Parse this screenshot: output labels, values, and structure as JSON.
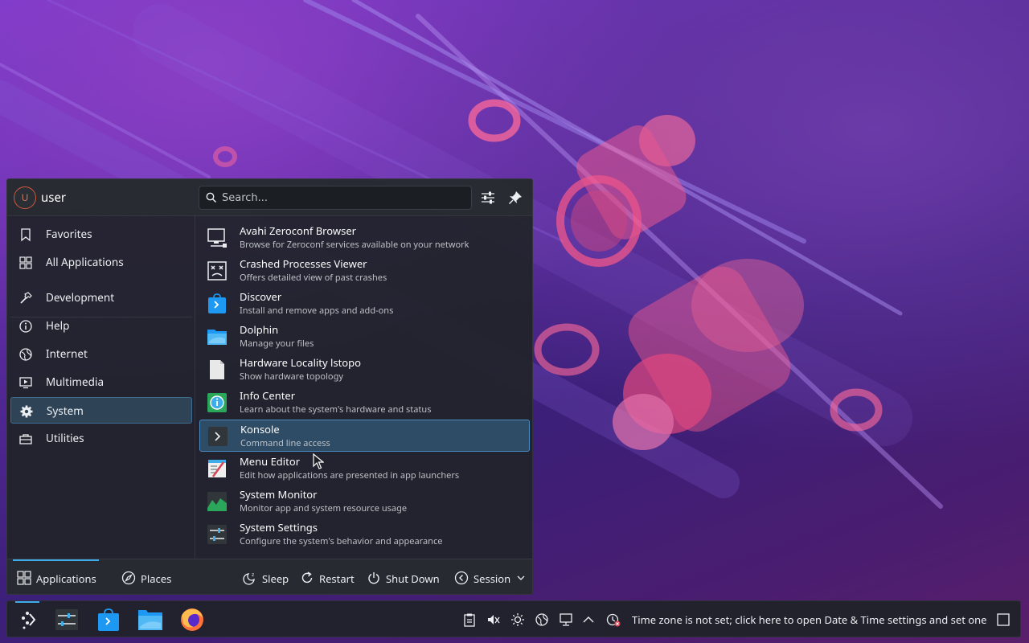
{
  "user": {
    "name": "user",
    "initial": "U"
  },
  "search": {
    "placeholder": "Search..."
  },
  "sidebar": {
    "items": [
      {
        "label": "Favorites"
      },
      {
        "label": "All Applications"
      },
      {
        "label": "Development"
      },
      {
        "label": "Help"
      },
      {
        "label": "Internet"
      },
      {
        "label": "Multimedia"
      },
      {
        "label": "System",
        "selected": true
      },
      {
        "label": "Utilities"
      }
    ]
  },
  "apps": [
    {
      "name": "Avahi Zeroconf Browser",
      "description": "Browse for Zeroconf services available on your network",
      "icon": "monitor-network-icon"
    },
    {
      "name": "Crashed Processes Viewer",
      "description": "Offers detailed view of past crashes",
      "icon": "crash-icon"
    },
    {
      "name": "Discover",
      "description": "Install and remove apps and add-ons",
      "icon": "discover-bag-icon"
    },
    {
      "name": "Dolphin",
      "description": "Manage your files",
      "icon": "folder-icon"
    },
    {
      "name": "Hardware Locality lstopo",
      "description": "Show hardware topology",
      "icon": "document-icon"
    },
    {
      "name": "Info Center",
      "description": "Learn about the system's hardware and status",
      "icon": "info-center-icon"
    },
    {
      "name": "Konsole",
      "description": "Command line access",
      "icon": "terminal-icon",
      "selected": true
    },
    {
      "name": "Menu Editor",
      "description": "Edit how applications are presented in app launchers",
      "icon": "menu-editor-icon"
    },
    {
      "name": "System Monitor",
      "description": "Monitor app and system resource usage",
      "icon": "system-monitor-icon"
    },
    {
      "name": "System Settings",
      "description": "Configure the system's behavior and appearance",
      "icon": "settings-sliders-icon"
    }
  ],
  "footer": {
    "applications": "Applications",
    "places": "Places",
    "sleep": "Sleep",
    "restart": "Restart",
    "shutdown": "Shut Down",
    "session": "Session"
  },
  "taskbar": {
    "timezone_text": "Time zone is not set; click here to open Date & Time settings and set one"
  },
  "colors": {
    "accent": "#3daee9",
    "panel_bg": "#202329",
    "selection_bg": "#2e4c66"
  }
}
